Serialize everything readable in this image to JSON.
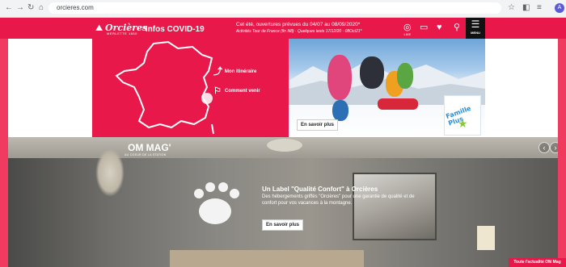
{
  "browser": {
    "url": "orcieres.com",
    "avatar_letter": "A"
  },
  "header": {
    "logo_name": "Orcières",
    "logo_subtitle": "MERLETTE 1850",
    "covid_link": "*Infos COVID-19",
    "notice_line1": "Cet été, ouvertures prévues du 04/07 au 08/09/2020*",
    "notice_line2": "Activités Tour de France (fin N8) · Quelques tests 17/12/20 · 08Oct21*",
    "icons": [
      {
        "name": "live-icon",
        "glyph": "◎",
        "label": "LIVE"
      },
      {
        "name": "forfaits-icon",
        "glyph": "▭",
        "label": ""
      },
      {
        "name": "favorites-icon",
        "glyph": "♥",
        "label": ""
      },
      {
        "name": "cart-icon",
        "glyph": "🛒",
        "label": ""
      }
    ],
    "menu_label": "MENU"
  },
  "map_panel": {
    "link1": "Mon itinéraire",
    "link2": "Comment venir"
  },
  "photo_panel": {
    "button": "En savoir plus",
    "badge_text": "Famille Plus"
  },
  "mag": {
    "title": "OM MAG'",
    "subtitle": "AU COEUR DE LA STATION",
    "heading": "Un Label \"Qualité Confort\" à Orcières",
    "description": "Des hébergements griffés \"Orcières\" pour une garantie de qualité et de confort pour vos vacances à la montagne.",
    "button": "En savoir plus",
    "footer_link": "Toute l'actualité OM Mag"
  },
  "colors": {
    "brand_pink": "#e8194a",
    "frame_pink": "#f03a5f"
  }
}
